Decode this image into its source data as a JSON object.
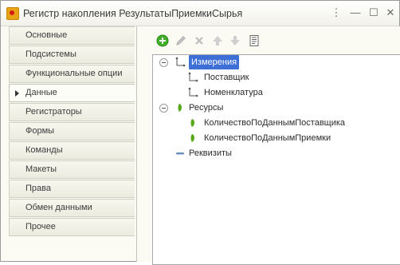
{
  "window": {
    "title": "Регистр накопления РезультатыПриемкиСырья",
    "buttons": {
      "more": "⋮",
      "minimize": "—",
      "maximize": "☐",
      "close": "✕"
    }
  },
  "sidebar": {
    "items": [
      {
        "label": "Основные",
        "active": false
      },
      {
        "label": "Подсистемы",
        "active": false
      },
      {
        "label": "Функциональные опции",
        "active": false
      },
      {
        "label": "Данные",
        "active": true
      },
      {
        "label": "Регистраторы",
        "active": false
      },
      {
        "label": "Формы",
        "active": false
      },
      {
        "label": "Команды",
        "active": false
      },
      {
        "label": "Макеты",
        "active": false
      },
      {
        "label": "Права",
        "active": false
      },
      {
        "label": "Обмен данными",
        "active": false
      },
      {
        "label": "Прочее",
        "active": false
      }
    ]
  },
  "toolbar": {
    "icons": [
      "add-icon",
      "edit-icon",
      "delete-icon",
      "move-up-icon",
      "move-down-icon",
      "sort-icon"
    ]
  },
  "tree": {
    "dimensions": {
      "label": "Измерения",
      "children": [
        "Поставщик",
        "Номенклатура"
      ]
    },
    "resources": {
      "label": "Ресурсы",
      "children": [
        "КоличествоПоДаннымПоставщика",
        "КоличествоПоДаннымПриемки"
      ]
    },
    "attributes": {
      "label": "Реквизиты"
    }
  },
  "colors": {
    "selection": "#3d6fd6",
    "resource_icon": "#58a91a",
    "add_icon": "#3fae27"
  }
}
